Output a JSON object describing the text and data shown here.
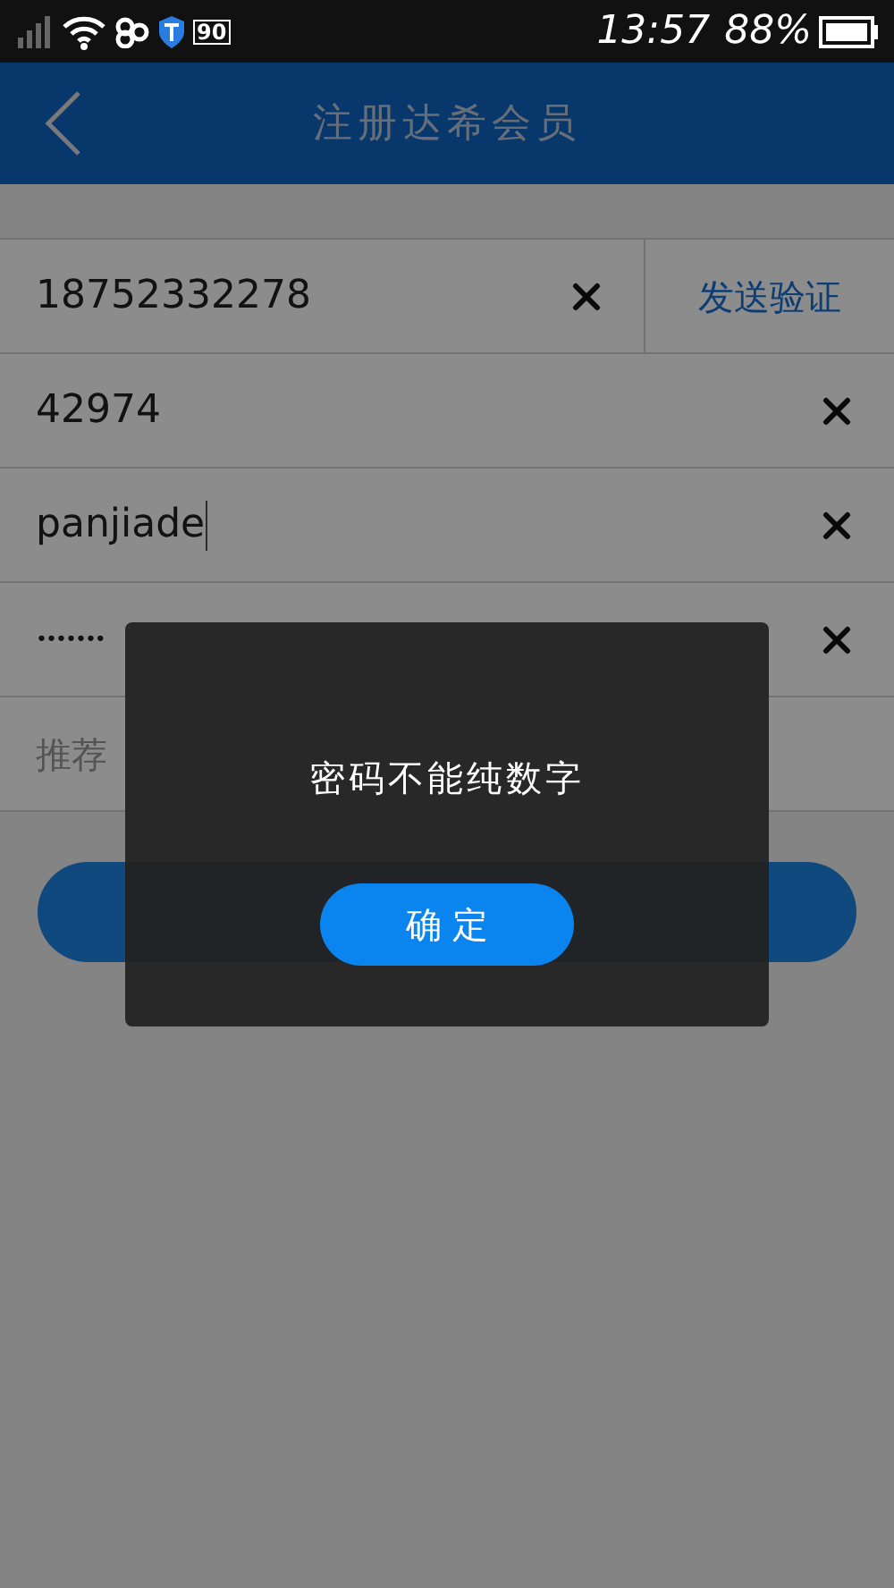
{
  "status_bar": {
    "badge": "90",
    "time": "13:57",
    "battery": "88%"
  },
  "header": {
    "title": "注册达希会员"
  },
  "fields": [
    {
      "kind": "phone",
      "value": "18752332278",
      "action": "发送验证",
      "clearable": true
    },
    {
      "kind": "text",
      "value": "42974",
      "clearable": true
    },
    {
      "kind": "text",
      "value": "panjiade",
      "clearable": true,
      "focused": true
    },
    {
      "kind": "password",
      "value": "•••••••",
      "clearable": true
    },
    {
      "kind": "hint",
      "placeholder": "推荐",
      "clearable": false
    }
  ],
  "dialog": {
    "message": "密码不能纯数字",
    "button": "确 定"
  }
}
